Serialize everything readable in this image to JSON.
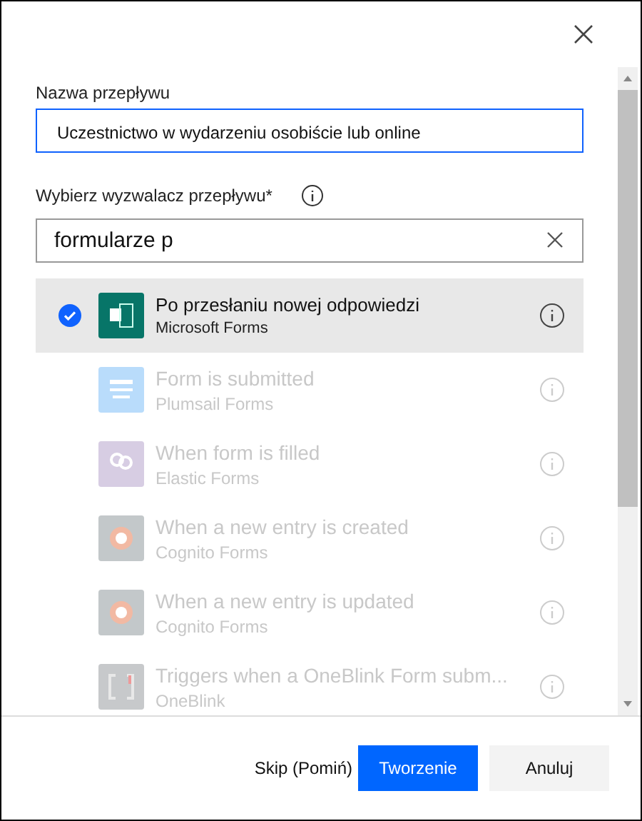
{
  "flow_name": {
    "label": "Nazwa przepływu",
    "value": "Uczestnictwo w wydarzeniu osobiście lub online"
  },
  "trigger": {
    "label": "Wybierz wyzwalacz przepływu*",
    "search_value": "formularze p"
  },
  "triggers": [
    {
      "kind": "forms",
      "title": "Po przesłaniu nowej odpowiedzi",
      "connector": "Microsoft Forms",
      "color": "#077568",
      "selected": true,
      "disabled": false
    },
    {
      "kind": "lines",
      "title": "Form is submitted",
      "connector": "Plumsail Forms",
      "color": "#b9dcfb",
      "selected": false,
      "disabled": true
    },
    {
      "kind": "rings",
      "title": "When form is filled",
      "connector": "Elastic Forms",
      "color": "#d7cde3",
      "selected": false,
      "disabled": true
    },
    {
      "kind": "gear",
      "title": "When a new entry is created",
      "connector": "Cognito Forms",
      "color": "#c3c8ca",
      "selected": false,
      "disabled": true
    },
    {
      "kind": "gear",
      "title": "When a new entry is updated",
      "connector": "Cognito Forms",
      "color": "#c3c8ca",
      "selected": false,
      "disabled": true
    },
    {
      "kind": "bracket",
      "title": "Triggers when a OneBlink Form subm...",
      "connector": "OneBlink",
      "color": "#c7c9cb",
      "selected": false,
      "disabled": true
    }
  ],
  "buttons": {
    "skip": "Skip (Pomiń)",
    "create": "Tworzenie",
    "cancel": "Anuluj"
  }
}
